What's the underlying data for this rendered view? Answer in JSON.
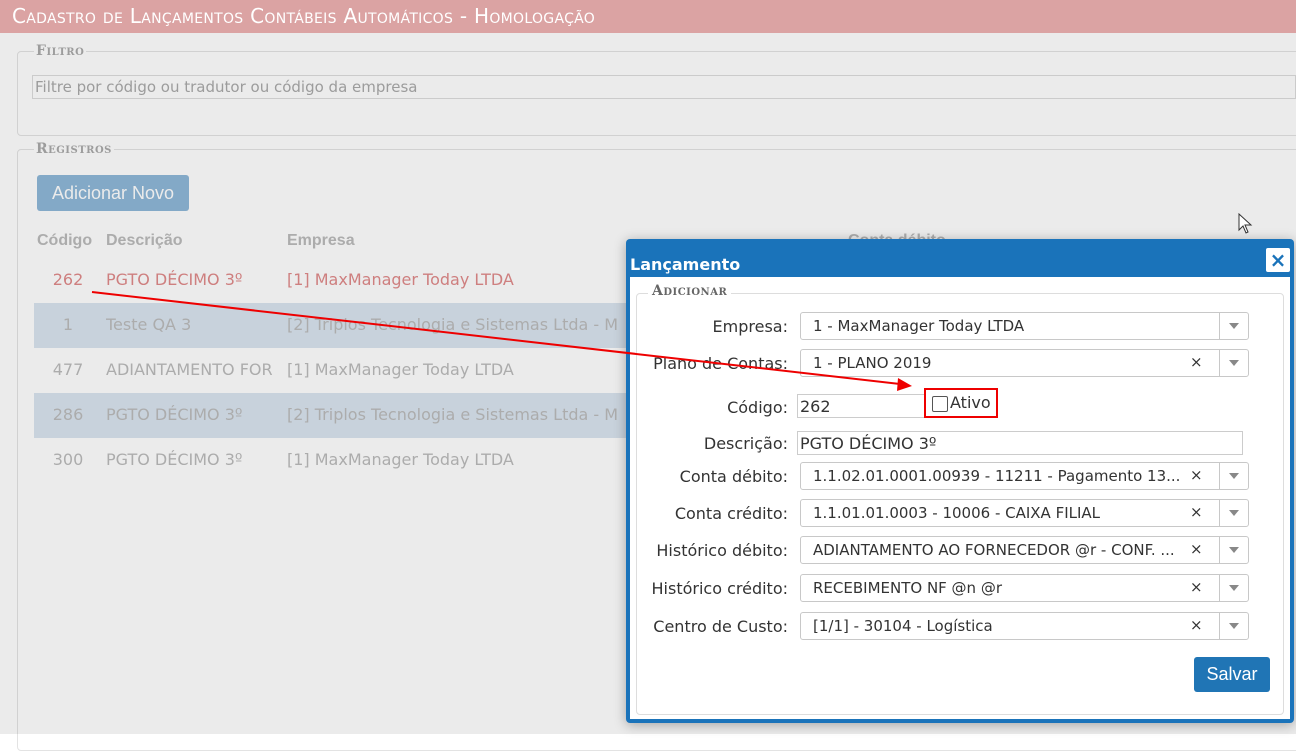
{
  "page": {
    "title": "Cadastro de Lançamentos Contábeis Automáticos  - Homologação"
  },
  "filter": {
    "legend": "Filtro",
    "placeholder": "Filtre por código ou tradutor ou código da empresa"
  },
  "records": {
    "legend": "Registros",
    "add_button": "Adicionar Novo",
    "columns": [
      "Código",
      "Descrição",
      "Empresa",
      "Conta débito"
    ],
    "rows": [
      {
        "codigo": "262",
        "descricao": "PGTO DÉCIMO 3º",
        "empresa": "[1] MaxManager Today LTDA"
      },
      {
        "codigo": "1",
        "descricao": "Teste QA 3",
        "empresa": "[2] Triplos Tecnologia e Sistemas Ltda - M"
      },
      {
        "codigo": "477",
        "descricao": "ADIANTAMENTO FOR",
        "empresa": "[1] MaxManager Today LTDA"
      },
      {
        "codigo": "286",
        "descricao": "PGTO DÉCIMO 3º",
        "empresa": "[2] Triplos Tecnologia e Sistemas Ltda - M"
      },
      {
        "codigo": "300",
        "descricao": "PGTO DÉCIMO 3º",
        "empresa": "[1] MaxManager Today LTDA"
      }
    ]
  },
  "modal": {
    "title": "Lançamento",
    "close_label": "×",
    "legend": "Adicionar",
    "fields": {
      "empresa": {
        "label": "Empresa:",
        "value": "1 - MaxManager Today LTDA"
      },
      "plano": {
        "label": "Plano de Contas:",
        "value": "1 - PLANO 2019"
      },
      "codigo": {
        "label": "Código:",
        "value": "262"
      },
      "ativo": {
        "label": "Ativo"
      },
      "descricao": {
        "label": "Descrição:",
        "value": "PGTO DÉCIMO 3º"
      },
      "conta_debito": {
        "label": "Conta débito:",
        "value": "1.1.02.01.0001.00939 - 11211 - Pagamento 13..."
      },
      "conta_credito": {
        "label": "Conta crédito:",
        "value": "1.1.01.01.0003 - 10006 - CAIXA FILIAL"
      },
      "historico_debito": {
        "label": "Histórico débito:",
        "value": "ADIANTAMENTO AO FORNECEDOR @r - CONF. ..."
      },
      "historico_credito": {
        "label": "Histórico crédito:",
        "value": "RECEBIMENTO NF @n @r"
      },
      "centro_custo": {
        "label": "Centro de Custo:",
        "value": "[1/1] - 30104 - Logística"
      }
    },
    "clear_glyph": "×",
    "save_button": "Salvar"
  },
  "colors": {
    "title_bar": "#dba3a3",
    "modal_header": "#1a73ba",
    "annotation": "#e00000"
  }
}
